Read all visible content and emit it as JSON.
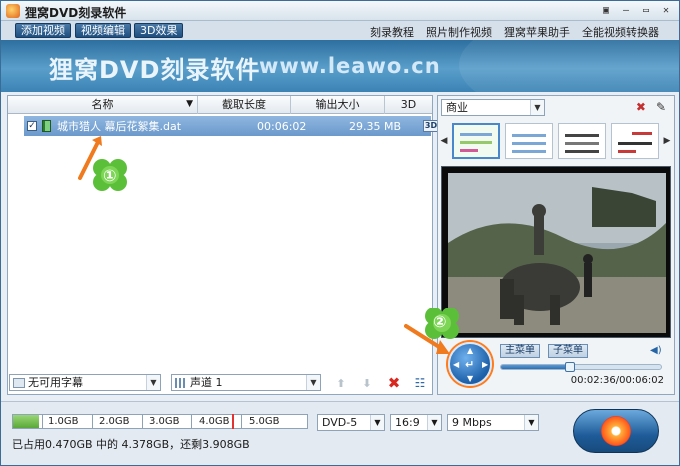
{
  "window": {
    "title": "狸窝DVD刻录软件",
    "controls": [
      "▣",
      "–",
      "▭",
      "✕"
    ]
  },
  "toolbar": {
    "add_video": "添加视频",
    "edit_video": "视频编辑",
    "effect_3d": "3D效果"
  },
  "menu_links": [
    "刻录教程",
    "照片制作视频",
    "狸窝苹果助手",
    "全能视频转换器"
  ],
  "banner": {
    "title": "狸窝DVD刻录软件",
    "url": "www.leawo.cn"
  },
  "list": {
    "columns": [
      "名称",
      "截取长度",
      "输出大小",
      "3D"
    ],
    "rows": [
      {
        "name": "城市猎人 幕后花絮集.dat",
        "duration": "00:06:02",
        "size": "29.35 MB",
        "checked": true
      }
    ]
  },
  "list_controls": {
    "subtitle": "无可用字幕",
    "audio": "声道 1"
  },
  "preview": {
    "theme": "商业",
    "main_menu": "主菜单",
    "sub_menu": "子菜单",
    "time": "00:02:36/00:06:02",
    "progress": 0.43
  },
  "hints": [
    "①",
    "②"
  ],
  "capacity": {
    "labels": [
      "1.0GB",
      "2.0GB",
      "3.0GB",
      "4.0GB",
      "5.0GB"
    ],
    "used_fraction": 0.088,
    "status": "已占用0.470GB 中的 4.378GB，还剩3.908GB"
  },
  "output": {
    "disc": "DVD-5",
    "aspect": "16:9",
    "bitrate": "9 Mbps"
  },
  "colors": {
    "accent": "#2d6f9f",
    "highlight": "#ff7b1c",
    "selection": "#7aa6d8"
  }
}
